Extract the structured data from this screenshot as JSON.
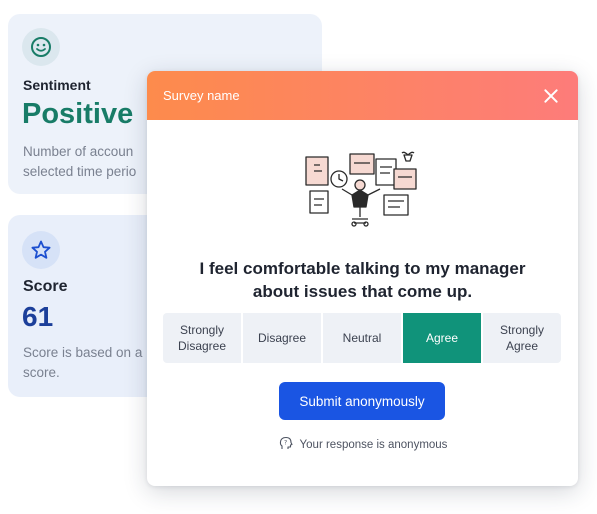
{
  "sentiment_card": {
    "icon": "smile-icon",
    "label": "Sentiment",
    "value": "Positive",
    "description": "Number of accoun",
    "description_line2": "selected time perio"
  },
  "score_card": {
    "icon": "star-icon",
    "label": "Score",
    "value": "61",
    "description": "Score is based on a",
    "description_line2": "score."
  },
  "modal": {
    "title": "Survey name",
    "close_icon": "close-icon",
    "illustration": "workplace-illustration",
    "question_line1": "I feel comfortable talking to my manager",
    "question_line2": "about issues that come up.",
    "options": [
      {
        "line1": "Strongly",
        "line2": "Disagree",
        "selected": false
      },
      {
        "line1": "Disagree",
        "line2": "",
        "selected": false
      },
      {
        "line1": "Neutral",
        "line2": "",
        "selected": false
      },
      {
        "line1": "Agree",
        "line2": "",
        "selected": true
      },
      {
        "line1": "Strongly",
        "line2": "Agree",
        "selected": false
      }
    ],
    "submit_label": "Submit anonymously",
    "anon_icon": "anonymous-head-icon",
    "anon_note": "Your response is anonymous"
  },
  "colors": {
    "header_gradient_start": "#fd8b4c",
    "header_gradient_end": "#fd7c7a",
    "selected_option": "#10937a",
    "submit_button": "#1a55e3",
    "positive_text": "#187c67",
    "score_text": "#1c3f9a"
  }
}
